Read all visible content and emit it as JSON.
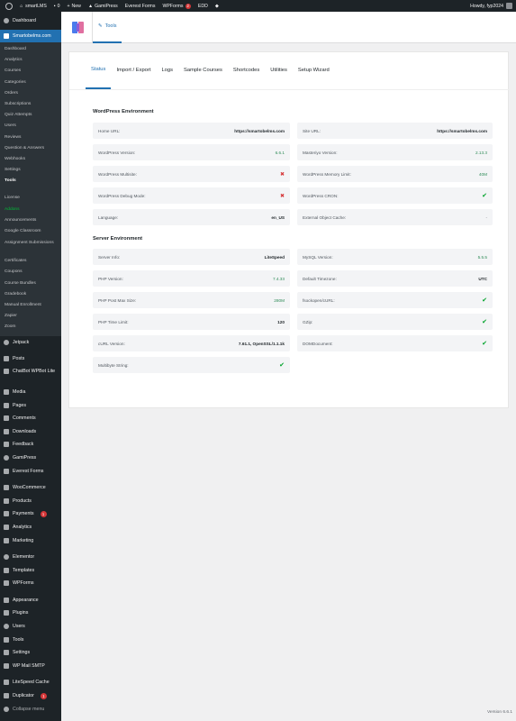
{
  "adminbar": {
    "site": "smartLMS",
    "comments": "0",
    "new": "New",
    "gamipress": "GamiPress",
    "everest": "Everest Forms",
    "wpforms": "WPForms",
    "wpforms_badge": "2",
    "edd": "EDD",
    "howdy": "Howdy, fyp2024"
  },
  "sidebar": {
    "dashboard": "Dashboard",
    "current": "Smartobelms.com",
    "submenu": [
      "Dashboard",
      "Analytics",
      "Courses",
      "Categories",
      "Orders",
      "Subscriptions",
      "Quiz Attempts",
      "Users",
      "Reviews",
      "Question & Answers",
      "Webhooks",
      "Settings",
      "Tools"
    ],
    "submenu2": [
      "License",
      "Addons",
      "Announcements",
      "Google Classroom",
      "Assignment Submissions",
      "Certificates",
      "Coupons",
      "Course Bundles",
      "Gradebook",
      "Manual Enrollment",
      "Zapier",
      "Zoom"
    ],
    "menu1": [
      "Jetpack"
    ],
    "menu2": [
      "Posts",
      "ChatBot WPBot Lite",
      "Media",
      "Pages",
      "Comments",
      "Downloads",
      "Feedback",
      "GamiPress",
      "Everest Forms"
    ],
    "menu3": [
      "WooCommerce",
      "Products",
      "Payments",
      "Analytics",
      "Marketing"
    ],
    "payments_badge": "1",
    "menu4": [
      "Elementor",
      "Templates",
      "WPForms"
    ],
    "menu5": [
      "Appearance",
      "Plugins",
      "Users",
      "Tools",
      "Settings",
      "WP Mail SMTP"
    ],
    "menu6": [
      "LiteSpeed Cache",
      "Duplicator",
      "Collapse menu"
    ],
    "duplicator_badge": "1"
  },
  "header": {
    "tools_label": "Tools"
  },
  "tabs": [
    "Status",
    "Import / Export",
    "Logs",
    "Sample Courses",
    "Shortcodes",
    "Utilities",
    "Setup Wizard"
  ],
  "wp_env": {
    "title": "WordPress Environment",
    "left": [
      {
        "label": "Home URL:",
        "value": "https://smartobelms.com"
      },
      {
        "label": "WordPress Version:",
        "value": "6.6.1"
      },
      {
        "label": "WordPress Multisite:",
        "value": "✖"
      },
      {
        "label": "WordPress Debug Mode:",
        "value": "✖"
      },
      {
        "label": "Language:",
        "value": "en_US"
      }
    ],
    "right": [
      {
        "label": "Site URL:",
        "value": "https://smartobelms.com"
      },
      {
        "label": "Masteriyo Version:",
        "value": "2.13.3"
      },
      {
        "label": "WordPress Memory Limit:",
        "value": "40M"
      },
      {
        "label": "WordPress CRON:",
        "value": "✔"
      },
      {
        "label": "External Object Cache:",
        "value": "-"
      }
    ]
  },
  "server_env": {
    "title": "Server Environment",
    "left": [
      {
        "label": "Server Info:",
        "value": "LiteSpeed"
      },
      {
        "label": "PHP Version:",
        "value": "7.4.33"
      },
      {
        "label": "PHP Post Max Size:",
        "value": "280M"
      },
      {
        "label": "PHP Time Limit:",
        "value": "120"
      },
      {
        "label": "cURL Version:",
        "value": "7.61.1, OpenSSL/1.1.1k"
      },
      {
        "label": "Multibyte String:",
        "value": "✔"
      }
    ],
    "right": [
      {
        "label": "MySQL Version:",
        "value": "5.5.5"
      },
      {
        "label": "Default Timezone:",
        "value": "UTC"
      },
      {
        "label": "fsockopen/cURL:",
        "value": "✔"
      },
      {
        "label": "GZip:",
        "value": "✔"
      },
      {
        "label": "DOMDocument:",
        "value": "✔"
      }
    ]
  },
  "footer": {
    "version": "Version 6.6.1"
  },
  "colors": {
    "accent": "#2271b1",
    "sidebar": "#1d2327",
    "green_check": "#00a32a",
    "red_cross": "#d63638"
  }
}
